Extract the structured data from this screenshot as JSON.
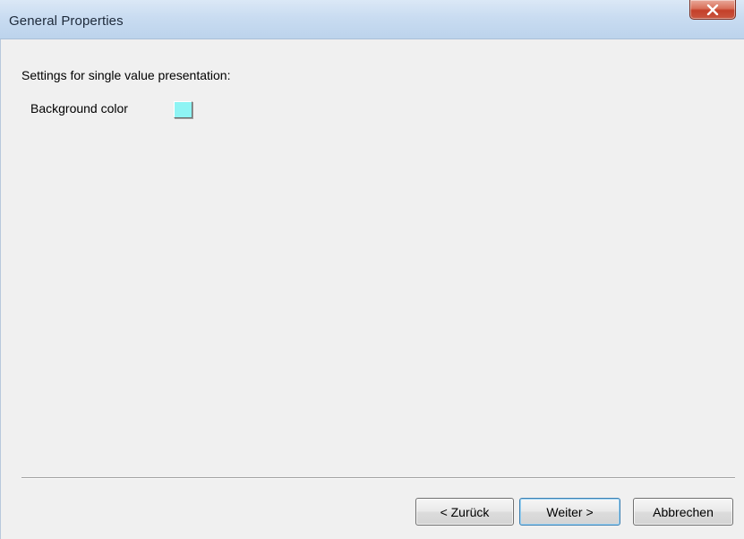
{
  "window": {
    "title": "General Properties",
    "close_icon": "close-icon"
  },
  "content": {
    "section_label": "Settings for single value presentation:",
    "background_color_label": "Background color",
    "background_color_value": "#8ef4f4"
  },
  "buttons": {
    "back_label": "< Zurück",
    "next_label": "Weiter >",
    "cancel_label": "Abbrechen"
  },
  "colors": {
    "titlebar": "#c9dcf1",
    "body": "#f0f0f0",
    "close_button": "#c4402a"
  }
}
